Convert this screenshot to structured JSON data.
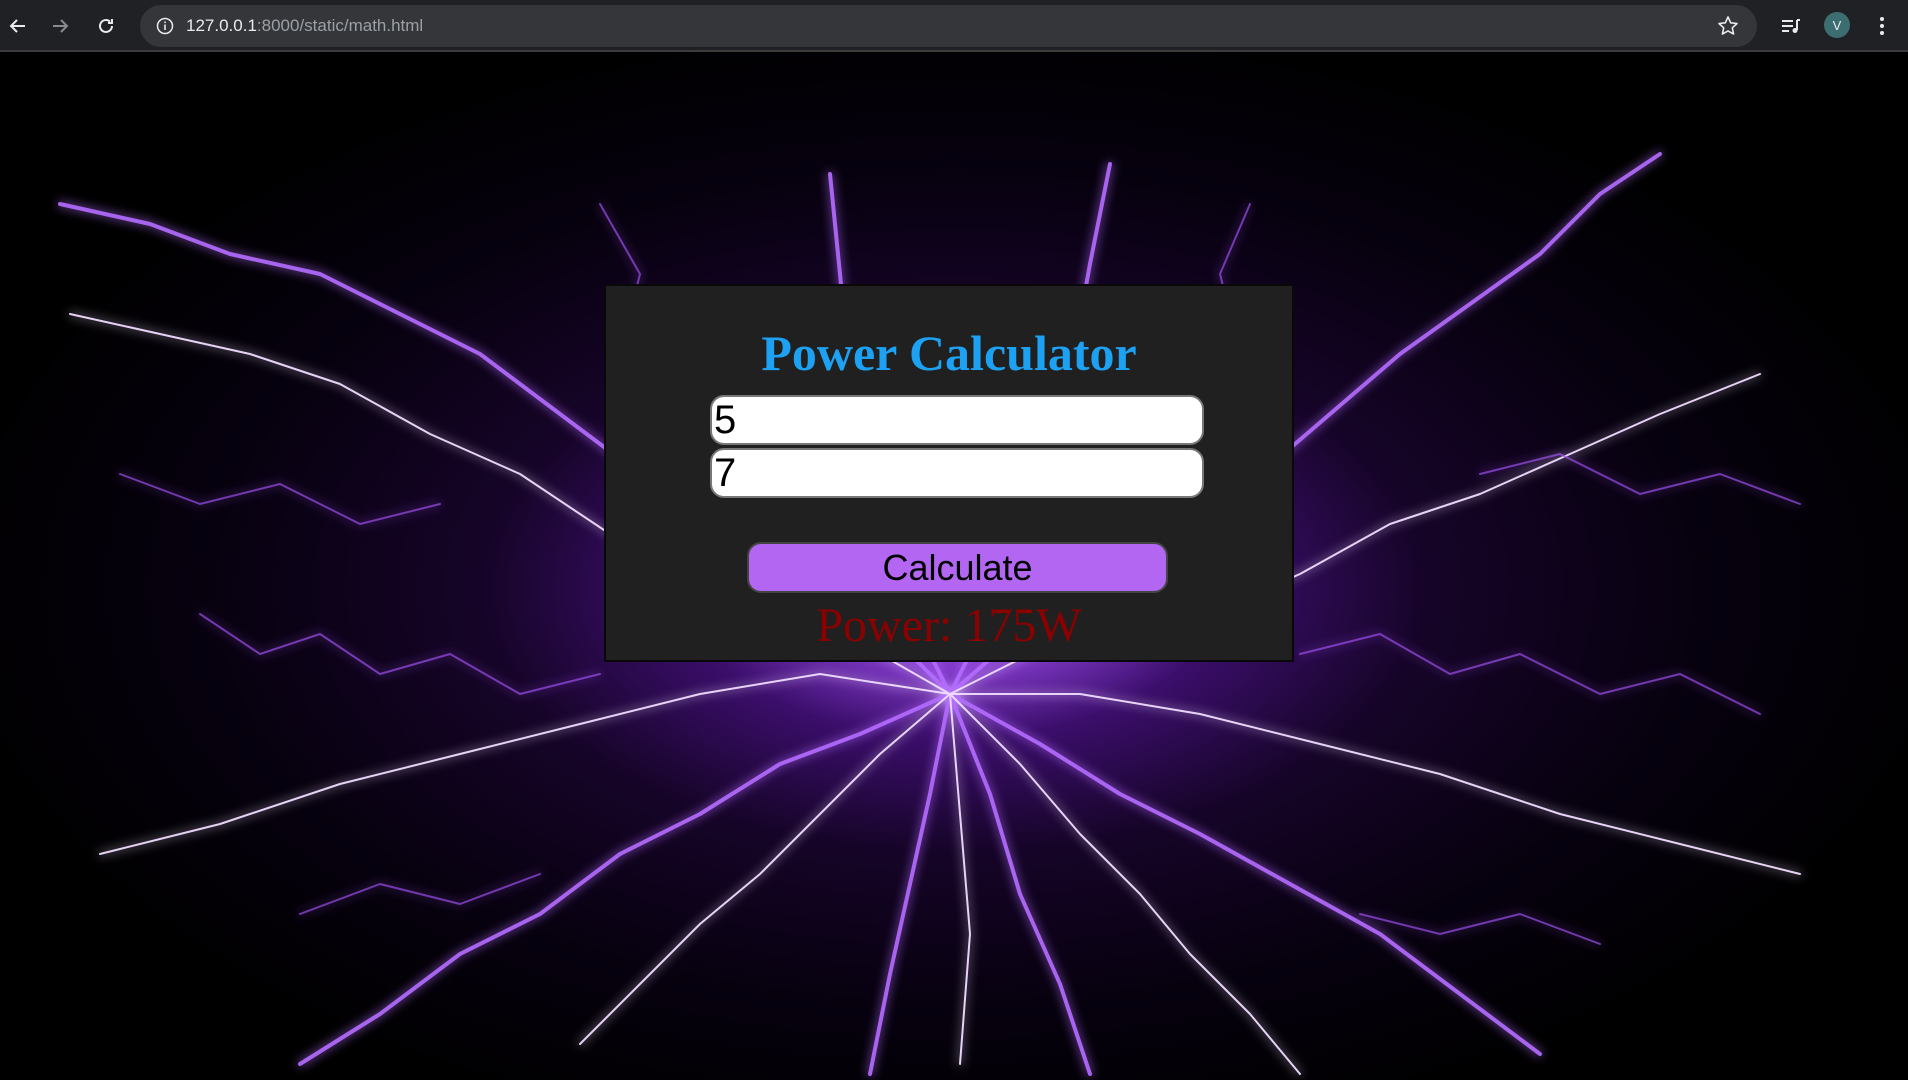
{
  "browser": {
    "url_host": "127.0.0.1",
    "url_rest": ":8000/static/math.html",
    "profile_initial": "V",
    "icons": [
      "back-arrow-icon",
      "forward-arrow-icon",
      "reload-icon",
      "site-info-icon",
      "bookmark-star-icon",
      "media-control-icon",
      "menu-kebab-icon"
    ]
  },
  "calculator": {
    "title": "Power Calculator",
    "input1_value": "5",
    "input2_value": "7",
    "button_label": "Calculate",
    "result_text": "Power: 175W"
  },
  "colors": {
    "title": "#1da1f2",
    "button": "#b366f2",
    "result": "#8b0000",
    "card": "#202020"
  }
}
